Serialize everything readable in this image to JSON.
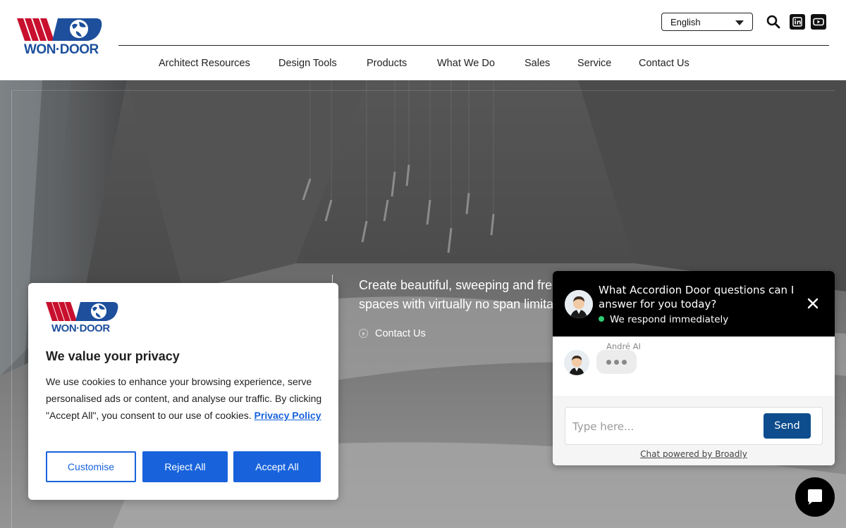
{
  "brand": {
    "logo_text": "WON·DOOR",
    "primary_color": "#1d4f9c",
    "accent_color": "#c8102e"
  },
  "header": {
    "language": "English",
    "icons": [
      "search-icon",
      "linkedin-icon",
      "youtube-icon"
    ]
  },
  "nav": {
    "items": [
      {
        "label": "Architect Resources"
      },
      {
        "label": "Design Tools"
      },
      {
        "label": "Products"
      },
      {
        "label": "What We Do"
      },
      {
        "label": "Sales"
      },
      {
        "label": "Service"
      },
      {
        "label": "Contact Us"
      }
    ]
  },
  "hero": {
    "line1": "Create beautiful, sweeping and fre",
    "line2": "spaces with virtually no span limita",
    "cta": "Contact Us"
  },
  "cookie": {
    "logo_text": "WON·DOOR",
    "title": "We value your privacy",
    "body": "We use cookies to enhance your browsing experience, serve personalised ads or content, and analyse our traffic. By clicking \"Accept All\", you consent to our use of cookies.",
    "policy_link": "Privacy Policy",
    "buttons": {
      "customise": "Customise",
      "reject": "Reject All",
      "accept": "Accept All"
    },
    "button_color": "#1863dc"
  },
  "chat": {
    "title": "What Accordion Door questions can I answer for you today?",
    "status": "We respond immediately",
    "status_color": "#2ecc71",
    "agent_name": "André AI",
    "input_placeholder": "Type here...",
    "send_label": "Send",
    "send_color": "#0d4d8d",
    "powered_by": "Chat powered by Broadly"
  }
}
